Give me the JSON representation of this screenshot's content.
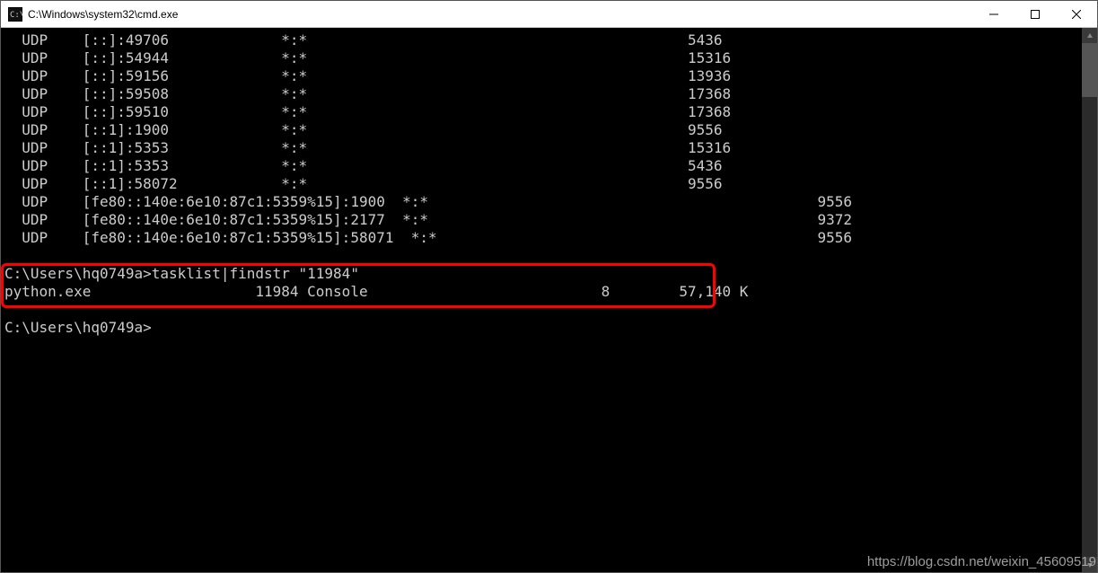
{
  "window": {
    "title": "C:\\Windows\\system32\\cmd.exe"
  },
  "netstat_lines": [
    {
      "proto": "UDP",
      "local": "[::]:49706",
      "foreign": "*:*",
      "pid": "5436"
    },
    {
      "proto": "UDP",
      "local": "[::]:54944",
      "foreign": "*:*",
      "pid": "15316"
    },
    {
      "proto": "UDP",
      "local": "[::]:59156",
      "foreign": "*:*",
      "pid": "13936"
    },
    {
      "proto": "UDP",
      "local": "[::]:59508",
      "foreign": "*:*",
      "pid": "17368"
    },
    {
      "proto": "UDP",
      "local": "[::]:59510",
      "foreign": "*:*",
      "pid": "17368"
    },
    {
      "proto": "UDP",
      "local": "[::1]:1900",
      "foreign": "*:*",
      "pid": "9556"
    },
    {
      "proto": "UDP",
      "local": "[::1]:5353",
      "foreign": "*:*",
      "pid": "15316"
    },
    {
      "proto": "UDP",
      "local": "[::1]:5353",
      "foreign": "*:*",
      "pid": "5436"
    },
    {
      "proto": "UDP",
      "local": "[::1]:58072",
      "foreign": "*:*",
      "pid": "9556"
    },
    {
      "proto": "UDP",
      "local": "[fe80::140e:6e10:87c1:5359%15]:1900",
      "foreign": "*:*",
      "pid": "9556"
    },
    {
      "proto": "UDP",
      "local": "[fe80::140e:6e10:87c1:5359%15]:2177",
      "foreign": "*:*",
      "pid": "9372"
    },
    {
      "proto": "UDP",
      "local": "[fe80::140e:6e10:87c1:5359%15]:58071",
      "foreign": "*:*",
      "pid": "9556"
    }
  ],
  "command": {
    "prompt1": "C:\\Users\\hq0749a>",
    "cmd1": "tasklist|findstr \"11984\"",
    "result_image": "python.exe",
    "result_pid": "11984",
    "result_session": "Console",
    "result_sessnum": "8",
    "result_mem": "57,140 K",
    "prompt2": "C:\\Users\\hq0749a>"
  },
  "watermark": "https://blog.csdn.net/weixin_45609519",
  "columns": {
    "proto": 2,
    "local": 9,
    "foreign": 32,
    "pid": 79,
    "tl_image": 0,
    "tl_pid": 30,
    "tl_session": 36,
    "tl_sessnum": 70,
    "tl_mem": 76
  }
}
